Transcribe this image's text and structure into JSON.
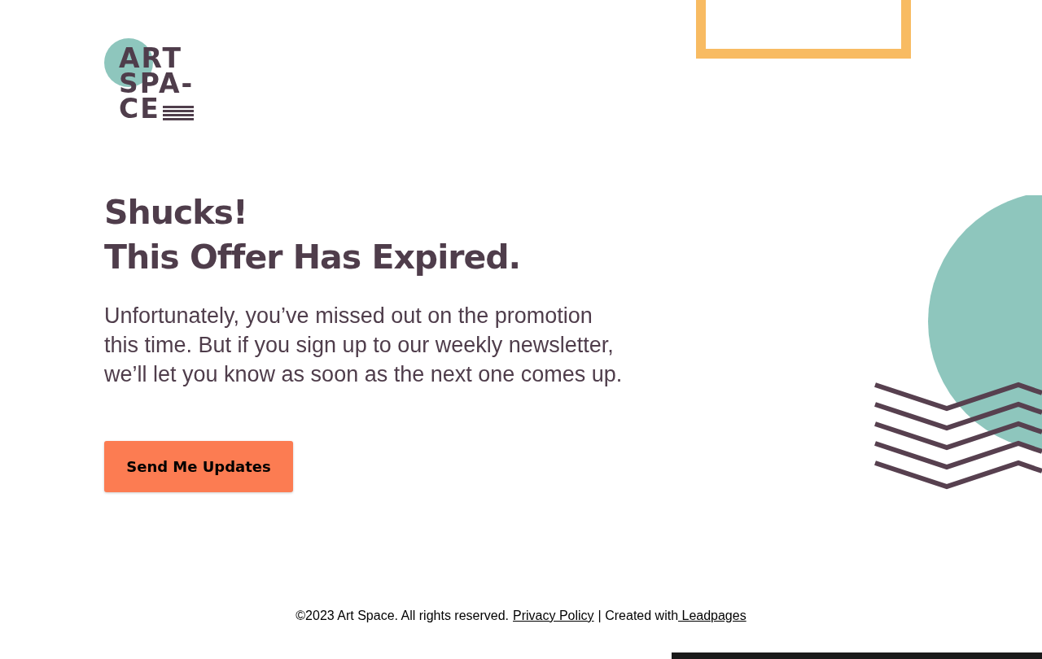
{
  "logo": {
    "lines": [
      "ART",
      "SPA-",
      "CE"
    ]
  },
  "heading": [
    "Shucks!",
    "This Offer Has Expired."
  ],
  "message": "Unfortunately, you’ve missed out on the promotion this time. But if you sign up to our weekly newsletter, we’ll let you know as soon as the next one comes up.",
  "button": "Send Me Updates",
  "footer": {
    "copyright": "©2023 Art Space. All rights reserved.",
    "privacy_link": "Privacy Policy",
    "separator": "| Created with",
    "leadpages_link": " Leadpages"
  }
}
